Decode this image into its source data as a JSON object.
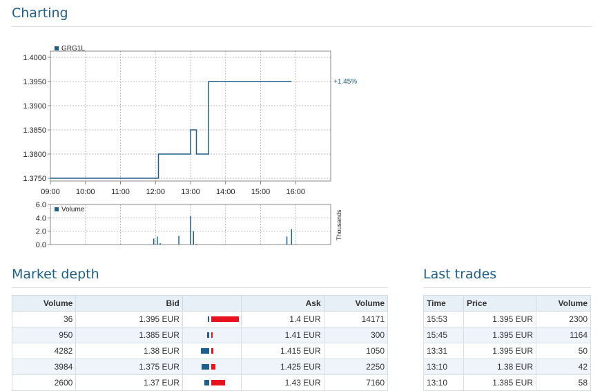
{
  "charting": {
    "title": "Charting",
    "legend_label": "GRG1L",
    "change_label": "+1.45%",
    "volume_legend": "Volume",
    "volume_unit": "Thousands"
  },
  "chart_data": [
    {
      "type": "line",
      "title": "",
      "series": [
        {
          "name": "GRG1L",
          "color": "#1d5f8c",
          "points": [
            [
              "09:00",
              1.375
            ],
            [
              "12:05",
              1.375
            ],
            [
              "12:05",
              1.38
            ],
            [
              "13:00",
              1.38
            ],
            [
              "13:00",
              1.385
            ],
            [
              "13:10",
              1.385
            ],
            [
              "13:10",
              1.38
            ],
            [
              "13:31",
              1.38
            ],
            [
              "13:31",
              1.395
            ],
            [
              "15:53",
              1.395
            ]
          ]
        }
      ],
      "x_ticks": [
        "09:00",
        "10:00",
        "11:00",
        "12:00",
        "13:00",
        "14:00",
        "15:00",
        "16:00"
      ],
      "y_ticks": [
        "1.3750",
        "1.3800",
        "1.3850",
        "1.3900",
        "1.3950",
        "1.4000"
      ],
      "ylim": [
        1.375,
        1.4
      ],
      "xlim": [
        "09:00",
        "17:00"
      ],
      "grid": true,
      "legend": "top-left"
    },
    {
      "type": "bar",
      "title": "",
      "ylabel": "Thousands",
      "series": [
        {
          "name": "Volume",
          "color": "#1d5f8c",
          "points": [
            [
              "11:57",
              0.9
            ],
            [
              "12:03",
              1.2
            ],
            [
              "12:08",
              0.2
            ],
            [
              "12:40",
              1.3
            ],
            [
              "13:00",
              4.3
            ],
            [
              "13:05",
              2.0
            ],
            [
              "13:10",
              0.1
            ],
            [
              "15:45",
              1.2
            ],
            [
              "15:53",
              2.3
            ]
          ]
        }
      ],
      "y_ticks": [
        "0.0",
        "2.0",
        "4.0",
        "6.0"
      ],
      "ylim": [
        0,
        6
      ],
      "xlim": [
        "09:00",
        "17:00"
      ],
      "grid": true,
      "legend": "top-left"
    }
  ],
  "market_depth": {
    "title": "Market depth",
    "columns": [
      "Volume",
      "Bid",
      "",
      "Ask",
      "Volume"
    ],
    "rows": [
      {
        "bid_volume": "36",
        "bid": "1.395 EUR",
        "bid_share": 0.02,
        "ask_share": 1.0,
        "ask": "1.4 EUR",
        "ask_volume": "14171"
      },
      {
        "bid_volume": "950",
        "bid": "1.385 EUR",
        "bid_share": 0.07,
        "ask_share": 0.05,
        "ask": "1.41 EUR",
        "ask_volume": "300"
      },
      {
        "bid_volume": "4282",
        "bid": "1.38 EUR",
        "bid_share": 0.3,
        "ask_share": 0.07,
        "ask": "1.415 EUR",
        "ask_volume": "1050"
      },
      {
        "bid_volume": "3984",
        "bid": "1.375 EUR",
        "bid_share": 0.28,
        "ask_share": 0.16,
        "ask": "1.425 EUR",
        "ask_volume": "2250"
      },
      {
        "bid_volume": "2600",
        "bid": "1.37 EUR",
        "bid_share": 0.18,
        "ask_share": 0.5,
        "ask": "1.43 EUR",
        "ask_volume": "7160"
      }
    ]
  },
  "last_trades": {
    "title": "Last trades",
    "columns": [
      "Time",
      "Price",
      "Volume"
    ],
    "rows": [
      {
        "time": "15:53",
        "price": "1.395 EUR",
        "volume": "2300"
      },
      {
        "time": "15:45",
        "price": "1.395 EUR",
        "volume": "1164"
      },
      {
        "time": "13:31",
        "price": "1.395 EUR",
        "volume": "50"
      },
      {
        "time": "13:10",
        "price": "1.38 EUR",
        "volume": "42"
      },
      {
        "time": "13:10",
        "price": "1.385 EUR",
        "volume": "58"
      }
    ]
  },
  "colors": {
    "accent": "#1d5f8c",
    "ask_bar": "#e8141c",
    "header_bg": "#e8f0f7",
    "alt_row_bg": "#eef4fa"
  }
}
